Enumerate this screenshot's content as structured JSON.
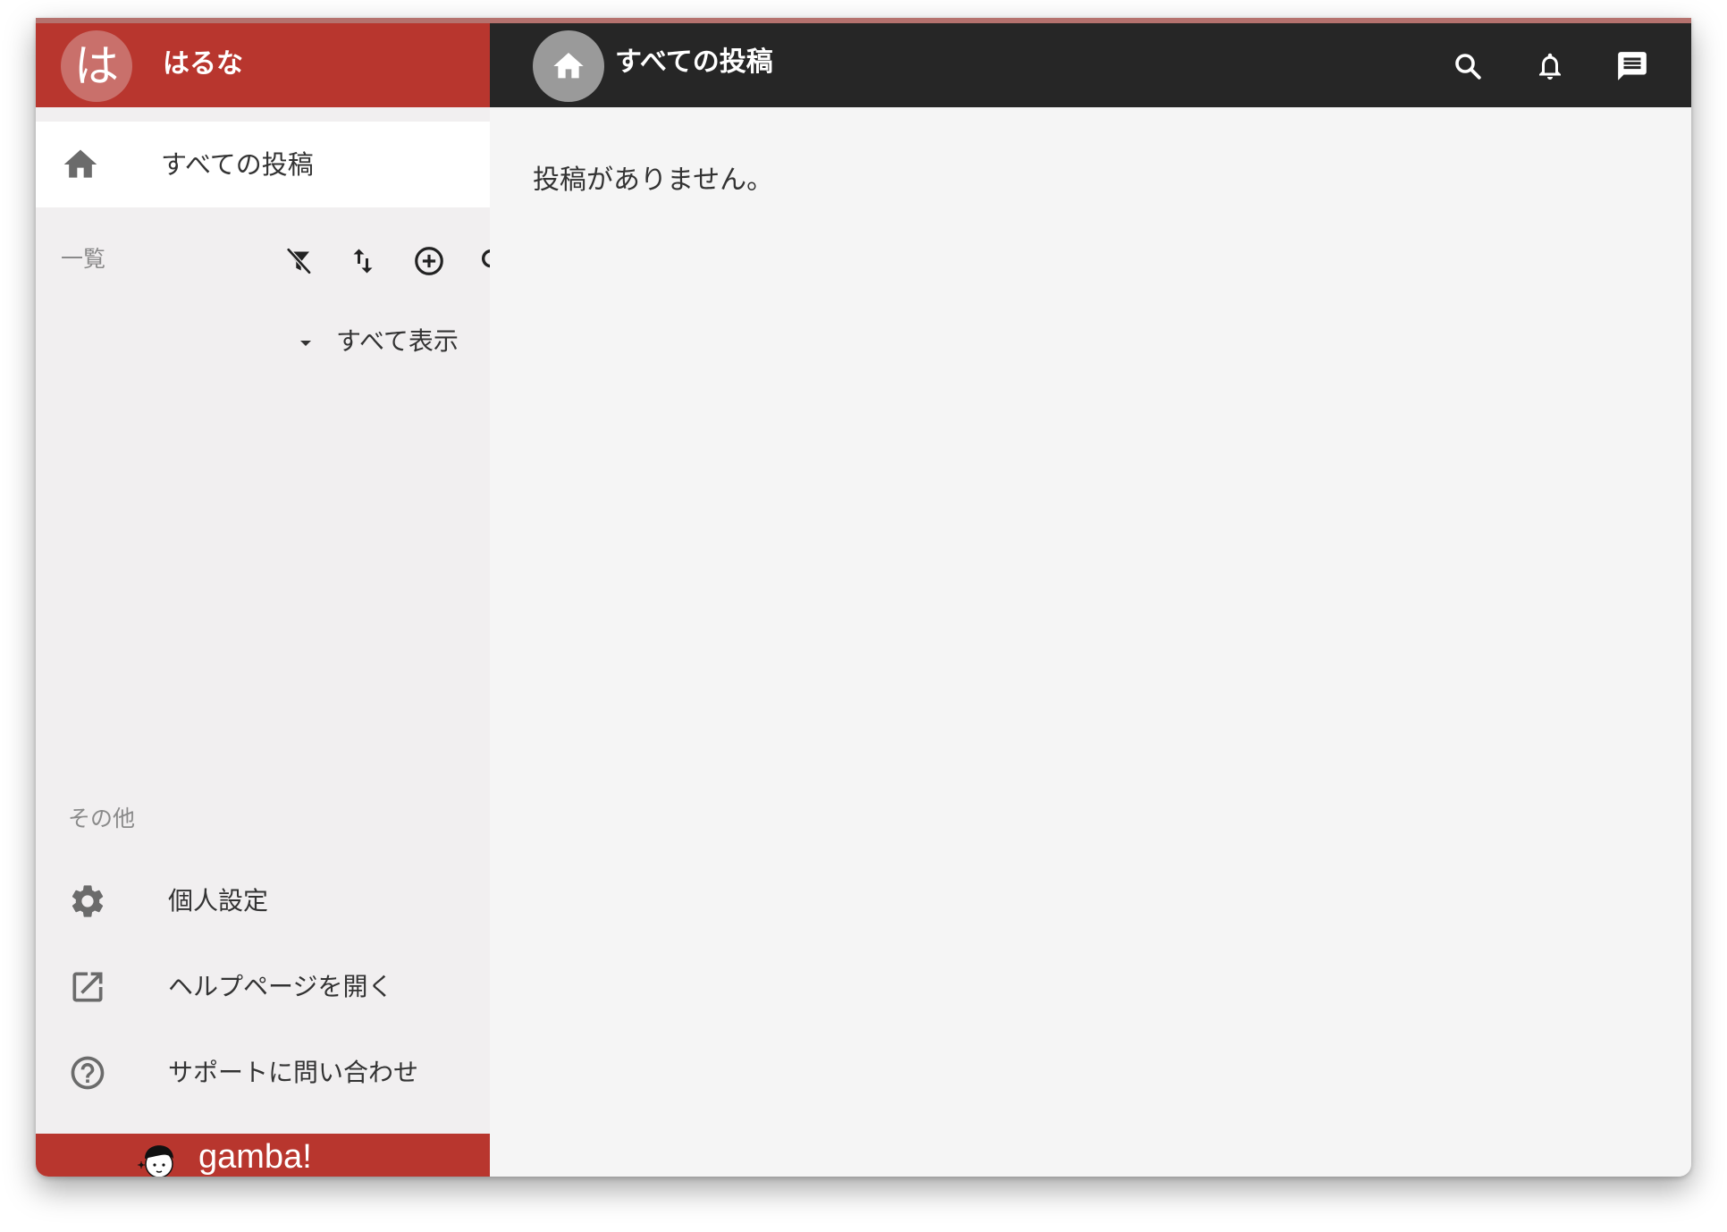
{
  "brand": {
    "avatar_char": "は",
    "name": "はるな",
    "accent_color": "#b8362e"
  },
  "sidebar": {
    "all_posts_label": "すべての投稿",
    "list_title": "一覧",
    "show_all_label": "すべて表示",
    "other_title": "その他",
    "items": [
      {
        "label": "個人設定",
        "icon": "gear-icon"
      },
      {
        "label": "ヘルプページを開く",
        "icon": "open-in-new-icon"
      },
      {
        "label": "サポートに問い合わせ",
        "icon": "help-circle-icon"
      }
    ],
    "footer_logo": "gamba!"
  },
  "appbar": {
    "title": "すべての投稿",
    "icons": [
      "search-icon",
      "bell-icon",
      "message-icon"
    ]
  },
  "main": {
    "empty_message": "投稿がありません。"
  }
}
